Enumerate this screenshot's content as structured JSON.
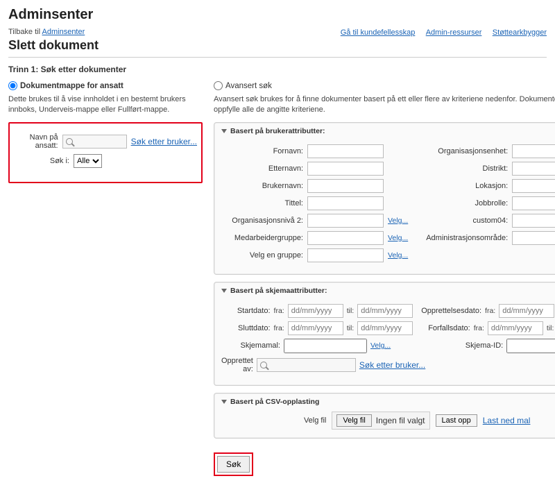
{
  "header": {
    "title": "Adminsenter",
    "back_prefix": "Tilbake til ",
    "back_link": "Adminsenter",
    "subtitle": "Slett dokument",
    "top_links": [
      "Gå til kundefellesskap",
      "Admin-ressurser",
      "Støttearkbygger"
    ]
  },
  "step": "Trinn 1: Søk etter dokumenter",
  "left": {
    "radio_label": "Dokumentmappe for ansatt",
    "desc": "Dette brukes til å vise innholdet i en bestemt brukers innboks, Underveis-mappe eller Fullført-mappe.",
    "name_label": "Navn på ansatt:",
    "search_user_link": "Søk etter bruker...",
    "search_in_label": "Søk i:",
    "search_in_options": [
      "Alle"
    ],
    "search_in_value": "Alle"
  },
  "right": {
    "radio_label": "Avansert søk",
    "desc": "Avansert søk brukes for å finne dokumenter basert på ett eller flere av kriteriene nedenfor. Dokumenter som hentes, vil oppfylle alle de angitte kriteriene.",
    "panel_user": {
      "title": "Basert på brukerattributter:",
      "left_fields": [
        "Fornavn:",
        "Etternavn:",
        "Brukernavn:",
        "Tittel:",
        "Organisasjonsnivå 2:",
        "Medarbeidergruppe:",
        "Velg en gruppe:"
      ],
      "right_fields": [
        "Organisasjonsenhet:",
        "Distrikt:",
        "Lokasjon:",
        "Jobbrolle:",
        "custom04:",
        "Administrasjonsområde:"
      ],
      "velg": "Velg..."
    },
    "panel_form": {
      "title": "Basert på skjemaattributter:",
      "startdate": "Startdato:",
      "enddate": "Sluttdato:",
      "created_label": "Opprettelsesdato:",
      "due_label": "Forfallsdato:",
      "from": "fra:",
      "to": "til:",
      "date_ph": "dd/mm/yyyy",
      "schema_tpl": "Skjemamal:",
      "schema_id": "Skjema-ID:",
      "created_by": "Opprettet av:",
      "search_user_link": "Søk etter bruker...",
      "velg": "Velg..."
    },
    "panel_csv": {
      "title": "Basert på CSV-opplasting",
      "choose_label": "Velg fil",
      "choose_btn": "Velg fil",
      "no_file": "Ingen fil valgt",
      "upload_btn": "Last opp",
      "download_template": "Last ned mal"
    }
  },
  "search_button": "Søk"
}
